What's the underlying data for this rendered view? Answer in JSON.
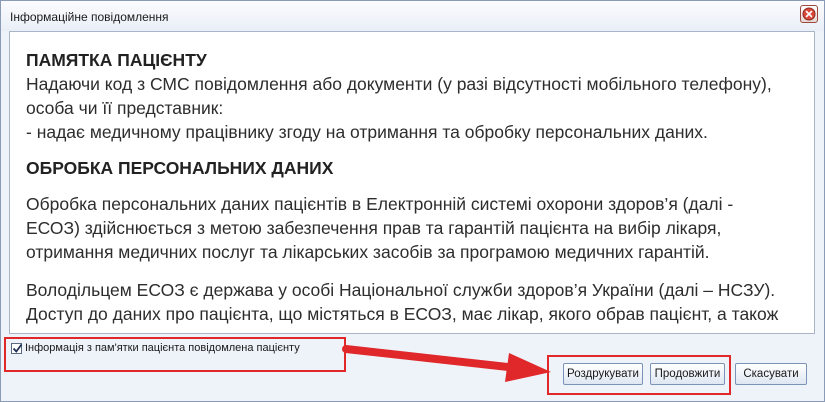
{
  "window": {
    "title": "Інформаційне повідомлення"
  },
  "content": {
    "heading1": "ПАМЯТКА ПАЦІЄНТУ",
    "para1_line1": "Надаючи код з СМС повідомлення або документи (у разі відсутності мобільного телефону),",
    "para1_line2": "особа чи її представник:",
    "para1_line3": "- надає медичному працівнику згоду на отримання та обробку персональних даних.",
    "heading2": "ОБРОБКА ПЕРСОНАЛЬНИХ ДАНИХ",
    "para2_line1": "Обробка персональних даних пацієнтів в Електронній системі охорони здоров’я (далі -",
    "para2_line2": "ЕСОЗ) здійснюється з метою забезпечення прав та гарантій пацієнта на вибір лікаря,",
    "para2_line3": "отримання медичних послуг та лікарських засобів за програмою медичних гарантій.",
    "para3_line1": "Володільцем ЕСОЗ є держава у особі Національної служби здоров’я України (далі – НСЗУ).",
    "para3_line2": "Доступ до даних про пацієнта, що містяться в ЕСОЗ, має лікар, якого обрав пацієнт, а також"
  },
  "footer": {
    "checkbox_label": "Інформація з пам'ятки пацієнта повідомлена пацієнту",
    "checkbox_checked": true
  },
  "buttons": {
    "print": "Роздрукувати",
    "continue": "Продовжити",
    "cancel": "Скасувати"
  },
  "colors": {
    "highlight": "#e0272a",
    "accent_border": "#7c93b8"
  }
}
